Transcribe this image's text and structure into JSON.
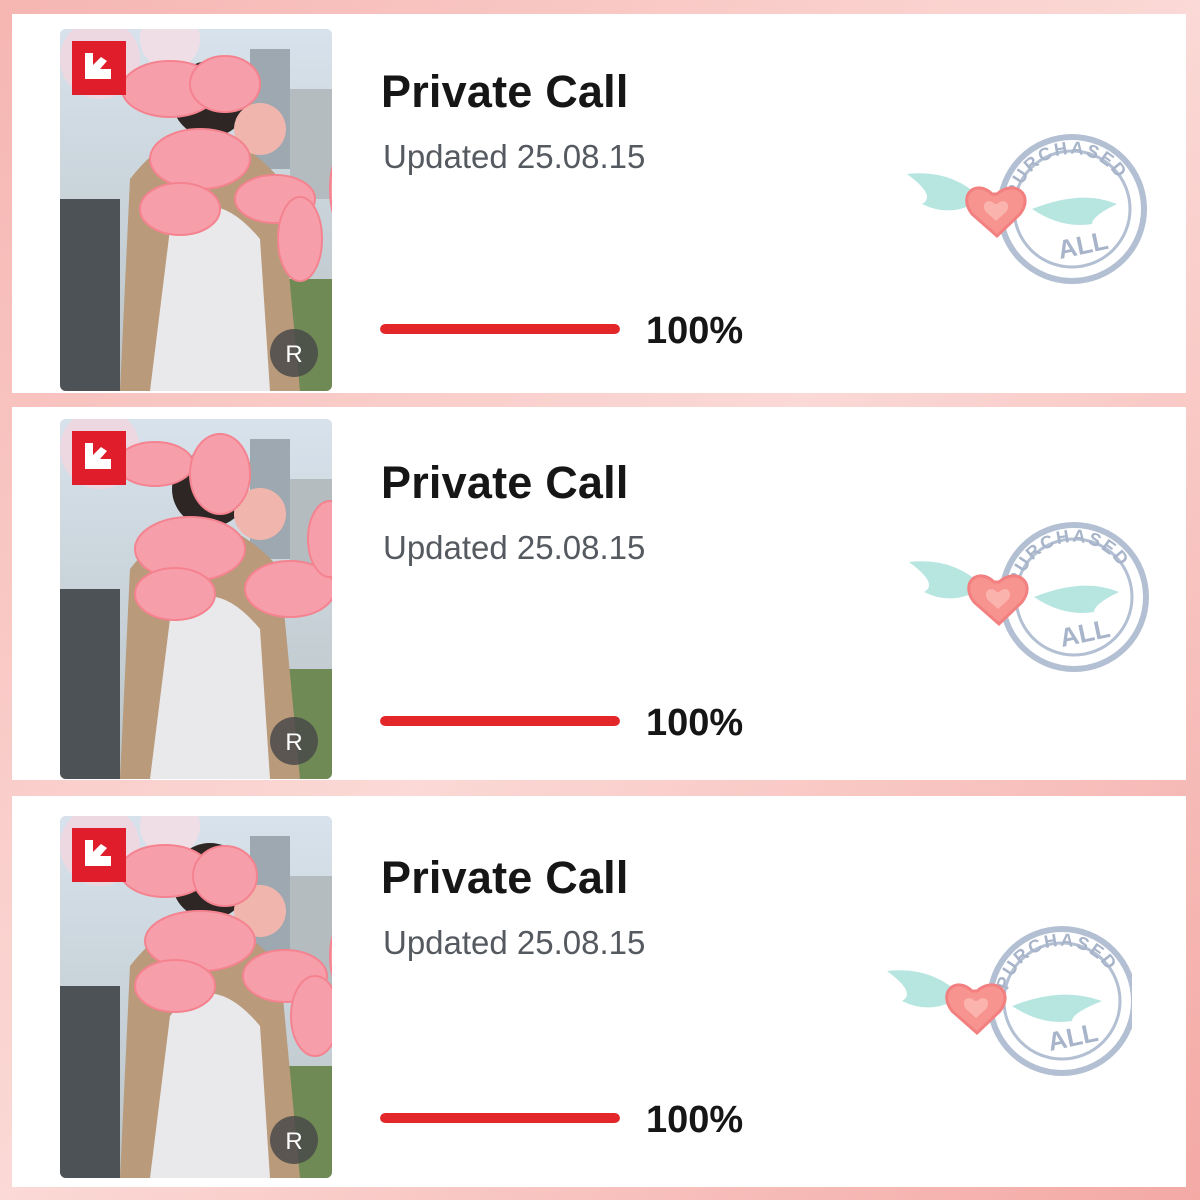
{
  "items": [
    {
      "title": "Private Call",
      "updated": "Updated 25.08.15",
      "progress_label": "100%",
      "progress": 1.0,
      "badge_rating": "R",
      "stamp_line1": "PURCHASED",
      "stamp_line2": "ALL"
    },
    {
      "title": "Private Call",
      "updated": "Updated 25.08.15",
      "progress_label": "100%",
      "progress": 1.0,
      "badge_rating": "R",
      "stamp_line1": "PURCHASED",
      "stamp_line2": "ALL"
    },
    {
      "title": "Private Call",
      "updated": "Updated 25.08.15",
      "progress_label": "100%",
      "progress": 1.0,
      "badge_rating": "R",
      "stamp_line1": "PURCHASED",
      "stamp_line2": "ALL"
    }
  ],
  "colors": {
    "accent": "#e2262a",
    "stamp": "#9fb0c8",
    "heart": "#f78b8b",
    "wing": "#a9e0dc",
    "balloon": "#f9a2ad"
  },
  "icons": {
    "platform_badge": "platform-logo-icon",
    "rating_badge": "rating-badge-icon",
    "stamp": "purchased-all-stamp-icon",
    "sticker": "balloon-dog-sticker-icon",
    "heart": "winged-heart-icon"
  }
}
